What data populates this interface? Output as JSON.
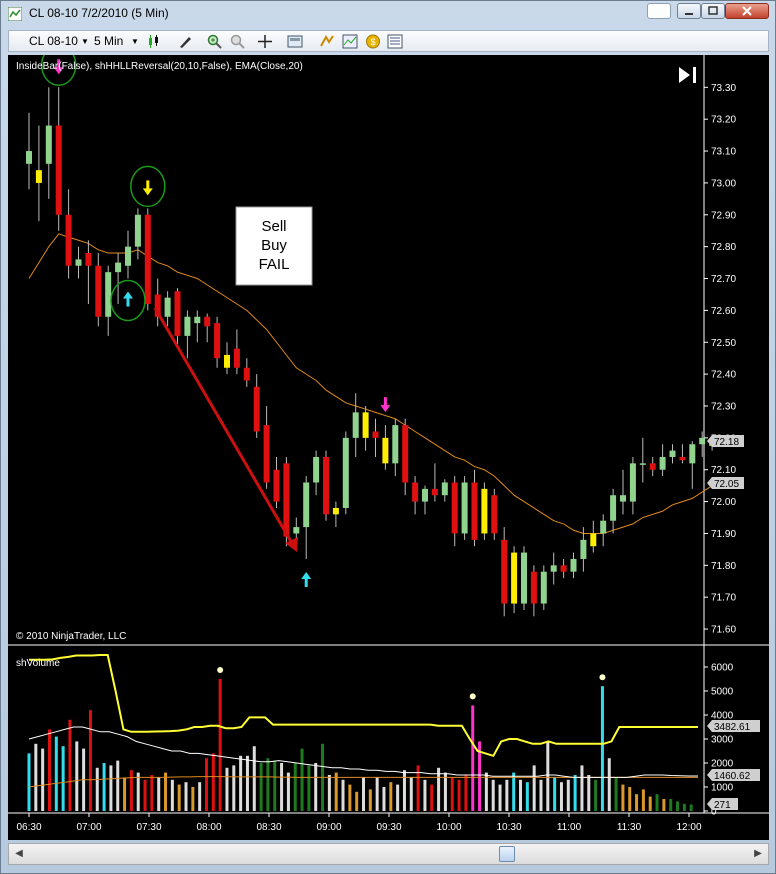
{
  "window": {
    "title": "CL 08-10  7/2/2010 (5 Min)"
  },
  "toolbar": {
    "instrument": "CL 08-10",
    "interval": "5 Min"
  },
  "price_panel": {
    "indicator_label": "InsideBar(False), shHHLLReversal(20,10,False), EMA(Close,20)",
    "copyright": "© 2010 NinjaTrader, LLC",
    "last_price_tag": "72.18",
    "ema_tag": "72.05",
    "annotation_lines": [
      "Sell",
      "Buy",
      "FAIL"
    ]
  },
  "volume_panel": {
    "label": "shVolume",
    "tags": [
      "3482.61",
      "1460.62",
      "271"
    ]
  },
  "colors": {
    "bull": "#8fd38f",
    "bear": "#e01010",
    "inside": "#ffee00",
    "ema": "#e08a1e",
    "vol_avg": "#ffff33",
    "vol_avg2": "#ffffff",
    "arrow_down": "#ff33cc",
    "arrow_up": "#33ddee",
    "circle": "#1a9a1a"
  },
  "chart_data": [
    {
      "type": "candlestick",
      "title": "",
      "x_ticks": [
        "06:30",
        "07:00",
        "07:30",
        "08:00",
        "08:30",
        "09:00",
        "09:30",
        "10:00",
        "10:30",
        "11:00",
        "11:30",
        "12:00"
      ],
      "ylim": [
        71.55,
        73.37
      ],
      "y_ticks": [
        "71.60",
        "71.70",
        "71.80",
        "71.90",
        "72.00",
        "72.10",
        "72.20",
        "72.30",
        "72.40",
        "72.50",
        "72.60",
        "72.70",
        "72.80",
        "72.90",
        "73.00",
        "73.10",
        "73.20",
        "73.30"
      ],
      "candles": [
        {
          "o": 73.1,
          "h": 73.22,
          "l": 72.98,
          "c": 73.06,
          "k": "bull"
        },
        {
          "o": 73.0,
          "h": 73.18,
          "l": 72.88,
          "c": 73.04,
          "k": "inside"
        },
        {
          "o": 73.06,
          "h": 73.3,
          "l": 72.95,
          "c": 73.18,
          "k": "bull"
        },
        {
          "o": 73.18,
          "h": 73.3,
          "l": 72.85,
          "c": 72.9,
          "k": "bear"
        },
        {
          "o": 72.9,
          "h": 72.98,
          "l": 72.7,
          "c": 72.74,
          "k": "bear"
        },
        {
          "o": 72.74,
          "h": 72.8,
          "l": 72.7,
          "c": 72.76,
          "k": "bull"
        },
        {
          "o": 72.78,
          "h": 72.82,
          "l": 72.62,
          "c": 72.74,
          "k": "bear"
        },
        {
          "o": 72.74,
          "h": 72.78,
          "l": 72.55,
          "c": 72.58,
          "k": "bear"
        },
        {
          "o": 72.58,
          "h": 72.74,
          "l": 72.52,
          "c": 72.72,
          "k": "bull"
        },
        {
          "o": 72.72,
          "h": 72.78,
          "l": 72.62,
          "c": 72.75,
          "k": "bull"
        },
        {
          "o": 72.74,
          "h": 72.85,
          "l": 72.7,
          "c": 72.8,
          "k": "bull"
        },
        {
          "o": 72.8,
          "h": 72.92,
          "l": 72.76,
          "c": 72.9,
          "k": "bull"
        },
        {
          "o": 72.9,
          "h": 72.92,
          "l": 72.6,
          "c": 72.62,
          "k": "bear"
        },
        {
          "o": 72.65,
          "h": 72.7,
          "l": 72.55,
          "c": 72.58,
          "k": "bear"
        },
        {
          "o": 72.58,
          "h": 72.66,
          "l": 72.55,
          "c": 72.64,
          "k": "bull"
        },
        {
          "o": 72.66,
          "h": 72.67,
          "l": 72.48,
          "c": 72.52,
          "k": "bear"
        },
        {
          "o": 72.52,
          "h": 72.6,
          "l": 72.45,
          "c": 72.58,
          "k": "bull"
        },
        {
          "o": 72.58,
          "h": 72.6,
          "l": 72.5,
          "c": 72.56,
          "k": "bull"
        },
        {
          "o": 72.58,
          "h": 72.59,
          "l": 72.5,
          "c": 72.55,
          "k": "bear"
        },
        {
          "o": 72.56,
          "h": 72.58,
          "l": 72.42,
          "c": 72.45,
          "k": "bear"
        },
        {
          "o": 72.46,
          "h": 72.5,
          "l": 72.4,
          "c": 72.42,
          "k": "inside"
        },
        {
          "o": 72.48,
          "h": 72.54,
          "l": 72.4,
          "c": 72.42,
          "k": "bear"
        },
        {
          "o": 72.42,
          "h": 72.45,
          "l": 72.36,
          "c": 72.38,
          "k": "bear"
        },
        {
          "o": 72.36,
          "h": 72.4,
          "l": 72.2,
          "c": 72.22,
          "k": "bear"
        },
        {
          "o": 72.24,
          "h": 72.3,
          "l": 72.04,
          "c": 72.06,
          "k": "bear"
        },
        {
          "o": 72.1,
          "h": 72.14,
          "l": 71.98,
          "c": 72.0,
          "k": "bear"
        },
        {
          "o": 72.12,
          "h": 72.14,
          "l": 71.86,
          "c": 71.89,
          "k": "bear"
        },
        {
          "o": 71.9,
          "h": 71.95,
          "l": 71.85,
          "c": 71.92,
          "k": "bull"
        },
        {
          "o": 71.92,
          "h": 72.08,
          "l": 71.82,
          "c": 72.06,
          "k": "bull"
        },
        {
          "o": 72.06,
          "h": 72.16,
          "l": 72.02,
          "c": 72.14,
          "k": "bull"
        },
        {
          "o": 72.14,
          "h": 72.16,
          "l": 71.94,
          "c": 71.96,
          "k": "bear"
        },
        {
          "o": 71.96,
          "h": 72.0,
          "l": 71.92,
          "c": 71.98,
          "k": "inside"
        },
        {
          "o": 71.98,
          "h": 72.22,
          "l": 71.96,
          "c": 72.2,
          "k": "bull"
        },
        {
          "o": 72.2,
          "h": 72.34,
          "l": 72.14,
          "c": 72.28,
          "k": "bull"
        },
        {
          "o": 72.28,
          "h": 72.3,
          "l": 72.16,
          "c": 72.2,
          "k": "inside"
        },
        {
          "o": 72.22,
          "h": 72.26,
          "l": 72.14,
          "c": 72.2,
          "k": "bear"
        },
        {
          "o": 72.2,
          "h": 72.24,
          "l": 72.1,
          "c": 72.12,
          "k": "inside"
        },
        {
          "o": 72.12,
          "h": 72.26,
          "l": 72.08,
          "c": 72.24,
          "k": "bull"
        },
        {
          "o": 72.24,
          "h": 72.26,
          "l": 72.02,
          "c": 72.06,
          "k": "bear"
        },
        {
          "o": 72.06,
          "h": 72.08,
          "l": 71.96,
          "c": 72.0,
          "k": "bear"
        },
        {
          "o": 72.0,
          "h": 72.05,
          "l": 71.96,
          "c": 72.04,
          "k": "bull"
        },
        {
          "o": 72.04,
          "h": 72.12,
          "l": 72.0,
          "c": 72.02,
          "k": "bear"
        },
        {
          "o": 72.02,
          "h": 72.07,
          "l": 72.0,
          "c": 72.06,
          "k": "bull"
        },
        {
          "o": 72.06,
          "h": 72.08,
          "l": 71.86,
          "c": 71.9,
          "k": "bear"
        },
        {
          "o": 71.9,
          "h": 72.08,
          "l": 71.88,
          "c": 72.06,
          "k": "bull"
        },
        {
          "o": 72.06,
          "h": 72.1,
          "l": 71.86,
          "c": 71.88,
          "k": "bear"
        },
        {
          "o": 72.04,
          "h": 72.06,
          "l": 71.88,
          "c": 71.9,
          "k": "inside"
        },
        {
          "o": 72.02,
          "h": 72.04,
          "l": 71.88,
          "c": 71.9,
          "k": "bear"
        },
        {
          "o": 71.88,
          "h": 71.92,
          "l": 71.64,
          "c": 71.68,
          "k": "bear"
        },
        {
          "o": 71.84,
          "h": 71.86,
          "l": 71.65,
          "c": 71.68,
          "k": "inside"
        },
        {
          "o": 71.68,
          "h": 71.86,
          "l": 71.66,
          "c": 71.84,
          "k": "bull"
        },
        {
          "o": 71.78,
          "h": 71.8,
          "l": 71.64,
          "c": 71.68,
          "k": "bear"
        },
        {
          "o": 71.68,
          "h": 71.8,
          "l": 71.66,
          "c": 71.78,
          "k": "bull"
        },
        {
          "o": 71.78,
          "h": 71.84,
          "l": 71.74,
          "c": 71.8,
          "k": "bull"
        },
        {
          "o": 71.8,
          "h": 71.82,
          "l": 71.76,
          "c": 71.78,
          "k": "bear"
        },
        {
          "o": 71.78,
          "h": 71.84,
          "l": 71.76,
          "c": 71.82,
          "k": "bull"
        },
        {
          "o": 71.82,
          "h": 71.92,
          "l": 71.78,
          "c": 71.88,
          "k": "bull"
        },
        {
          "o": 71.86,
          "h": 71.94,
          "l": 71.84,
          "c": 71.9,
          "k": "inside"
        },
        {
          "o": 71.9,
          "h": 71.96,
          "l": 71.86,
          "c": 71.94,
          "k": "bull"
        },
        {
          "o": 71.94,
          "h": 72.04,
          "l": 71.9,
          "c": 72.02,
          "k": "bull"
        },
        {
          "o": 72.02,
          "h": 72.1,
          "l": 71.96,
          "c": 72.0,
          "k": "bull"
        },
        {
          "o": 72.0,
          "h": 72.14,
          "l": 71.96,
          "c": 72.12,
          "k": "bull"
        },
        {
          "o": 72.12,
          "h": 72.2,
          "l": 72.06,
          "c": 72.12,
          "k": "bull"
        },
        {
          "o": 72.12,
          "h": 72.14,
          "l": 72.08,
          "c": 72.1,
          "k": "bear"
        },
        {
          "o": 72.1,
          "h": 72.18,
          "l": 72.08,
          "c": 72.14,
          "k": "bull"
        },
        {
          "o": 72.14,
          "h": 72.18,
          "l": 72.12,
          "c": 72.16,
          "k": "bull"
        },
        {
          "o": 72.14,
          "h": 72.18,
          "l": 72.12,
          "c": 72.13,
          "k": "bear"
        },
        {
          "o": 72.12,
          "h": 72.19,
          "l": 72.04,
          "c": 72.18,
          "k": "bull"
        },
        {
          "o": 72.18,
          "h": 72.22,
          "l": 72.14,
          "c": 72.2,
          "k": "bull"
        },
        {
          "o": 72.18,
          "h": 72.2,
          "l": 72.16,
          "c": 72.18,
          "k": "inside"
        }
      ],
      "ema": [
        72.7,
        72.75,
        72.8,
        72.84,
        72.83,
        72.82,
        72.81,
        72.79,
        72.78,
        72.78,
        72.78,
        72.79,
        72.77,
        72.75,
        72.74,
        72.72,
        72.71,
        72.7,
        72.68,
        72.66,
        72.64,
        72.62,
        72.6,
        72.57,
        72.54,
        72.5,
        72.46,
        72.42,
        72.4,
        72.38,
        72.35,
        72.33,
        72.31,
        72.3,
        72.29,
        72.28,
        72.27,
        72.26,
        72.24,
        72.22,
        72.2,
        72.18,
        72.16,
        72.14,
        72.13,
        72.11,
        72.1,
        72.08,
        72.05,
        72.02,
        72.0,
        71.98,
        71.96,
        71.94,
        71.93,
        71.91,
        71.9,
        71.9,
        71.9,
        71.91,
        71.92,
        71.93,
        71.95,
        71.96,
        71.97,
        71.99,
        72.0,
        72.01,
        72.03,
        72.05
      ],
      "markers": [
        {
          "i": 3,
          "dir": "down",
          "color": "magenta",
          "circled": true
        },
        {
          "i": 12,
          "dir": "down",
          "color": "yellow",
          "circled": true
        },
        {
          "i": 10,
          "dir": "up",
          "color": "cyan",
          "circled": true
        },
        {
          "i": 28,
          "dir": "up",
          "color": "cyan",
          "circled": false
        },
        {
          "i": 36,
          "dir": "down",
          "color": "magenta",
          "circled": false
        }
      ]
    },
    {
      "type": "bar",
      "title": "",
      "ylim": [
        0,
        6500
      ],
      "y_ticks": [
        "0",
        "1000",
        "2000",
        "3000",
        "4000",
        "5000",
        "6000"
      ],
      "volumes": [
        2400,
        2800,
        2600,
        3400,
        3100,
        2700,
        3800,
        2900,
        2600,
        4200,
        1800,
        2000,
        1900,
        2100,
        1400,
        1700,
        1600,
        1300,
        1500,
        1400,
        1600,
        1300,
        1100,
        1200,
        1000,
        1200,
        2200,
        2400,
        5500,
        1800,
        1900,
        2300,
        2300,
        2700,
        2000,
        2200,
        2100,
        2000,
        1600,
        2000,
        2600,
        1900,
        2000,
        2800,
        1500,
        1600,
        1300,
        1100,
        800,
        1400,
        900,
        1400,
        1000,
        1200,
        1100,
        1700,
        1400,
        1900,
        1300,
        1100,
        1800,
        1600,
        1400,
        1300,
        1500,
        4400,
        2900,
        1600,
        1300,
        1100,
        1300,
        1600,
        1300,
        1200,
        1900,
        1300,
        2900,
        1400,
        1200,
        1300,
        1500,
        1900,
        1500,
        1300,
        5200,
        2200,
        1400,
        1100,
        1000,
        700,
        900,
        600,
        700,
        500,
        500,
        400,
        300,
        271
      ],
      "vol_kinds": [
        "c",
        "w",
        "w",
        "r",
        "c",
        "c",
        "r",
        "w",
        "w",
        "r",
        "w",
        "c",
        "w",
        "w",
        "o",
        "r",
        "w",
        "r",
        "r",
        "w",
        "o",
        "w",
        "o",
        "w",
        "o",
        "w",
        "r",
        "r",
        "r",
        "w",
        "w",
        "w",
        "w",
        "w",
        "g",
        "g",
        "g",
        "w",
        "w",
        "g",
        "g",
        "g",
        "w",
        "g",
        "w",
        "o",
        "w",
        "o",
        "o",
        "w",
        "o",
        "w",
        "w",
        "o",
        "w",
        "w",
        "w",
        "r",
        "w",
        "r",
        "w",
        "w",
        "r",
        "r",
        "r",
        "m",
        "m",
        "w",
        "w",
        "w",
        "w",
        "c",
        "w",
        "c",
        "w",
        "w",
        "w",
        "c",
        "w",
        "w",
        "c",
        "w",
        "w",
        "g",
        "c",
        "w",
        "g",
        "o",
        "o",
        "o",
        "o",
        "o",
        "g",
        "o",
        "g",
        "g",
        "g",
        "g"
      ],
      "avg_yellow": [
        6300,
        6300,
        6300,
        6320,
        6380,
        6420,
        6480,
        6480,
        6480,
        6500,
        6500,
        5000,
        3400,
        3300,
        3300,
        3300,
        3310,
        3320,
        3330,
        3350,
        3400,
        3500,
        3500,
        3550,
        3550,
        3450,
        3450,
        3500,
        3900,
        3900,
        3900,
        3600,
        3600,
        3600,
        3600,
        3600,
        3600,
        3600,
        3600,
        3600,
        3600,
        3600,
        3600,
        3600,
        3600,
        3600,
        3600,
        3600,
        3600,
        3600,
        3600,
        3600,
        3550,
        3550,
        3550,
        3550,
        3000,
        2500,
        2400,
        2300,
        2900,
        3000,
        3000,
        2900,
        2800,
        2800,
        2900,
        2800,
        2800,
        2800,
        2800,
        2800,
        2800,
        2800,
        2900,
        3500,
        3500,
        3500,
        3500,
        3500,
        3500,
        3500,
        3500,
        3500,
        3500,
        3500
      ],
      "avg_white": [
        3000,
        3100,
        3200,
        3300,
        3400,
        3500,
        3500,
        3400,
        3300,
        3300,
        3200,
        3100,
        2900,
        2800,
        2700,
        2600,
        2500,
        2500,
        2400,
        2400,
        2350,
        2300,
        2250,
        2200,
        2150,
        2100,
        2050,
        2050,
        2100,
        2050,
        2000,
        1950,
        1900,
        1850,
        1800,
        1800,
        1750,
        1750,
        1700,
        1700,
        1650,
        1650,
        1600,
        1600,
        1600,
        1550,
        1550,
        1550,
        1500,
        1500,
        1500,
        1500,
        1450,
        1450,
        1450,
        1450,
        1450,
        1450,
        1500,
        1500,
        1450,
        1400,
        1400,
        1400,
        1400,
        1400,
        1400,
        1400,
        1450,
        1500,
        1500,
        1500,
        1480,
        1470,
        1460,
        1460
      ],
      "avg_orange": [
        1000,
        1050,
        1100,
        1150,
        1200,
        1250,
        1300,
        1300,
        1320,
        1340,
        1360,
        1380,
        1400,
        1400,
        1400,
        1400,
        1410,
        1420,
        1420,
        1430,
        1430,
        1430,
        1430,
        1420,
        1420,
        1420,
        1420,
        1420,
        1410,
        1410,
        1400,
        1400,
        1400,
        1400,
        1400,
        1400,
        1400,
        1400,
        1400,
        1400,
        1400,
        1400,
        1400,
        1400,
        1400,
        1400,
        1400,
        1400,
        1400,
        1400,
        1400,
        1400,
        1400,
        1400,
        1400,
        1400,
        1400,
        1400,
        1400,
        1400,
        1400,
        1400,
        1400,
        1400,
        1400,
        1400,
        1400,
        1400,
        1400,
        1400,
        1400,
        1400,
        1400,
        1400,
        1400,
        1400
      ],
      "spike_markers": [
        28,
        65,
        84
      ]
    }
  ]
}
